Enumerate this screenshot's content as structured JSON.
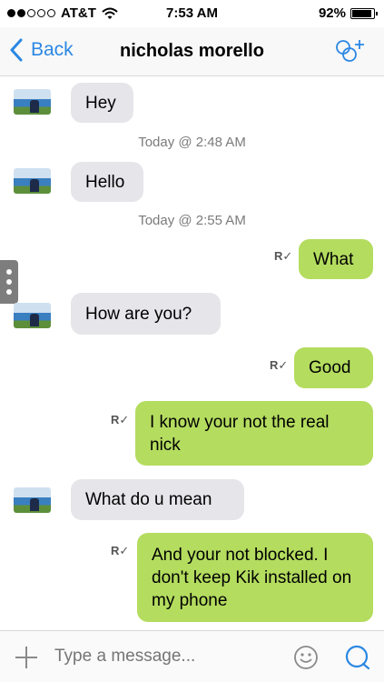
{
  "status_bar": {
    "carrier": "AT&T",
    "time": "7:53 AM",
    "battery": "92%",
    "battery_level": 0.92
  },
  "nav": {
    "back_label": "Back",
    "title": "nicholas morello"
  },
  "timestamps": [
    "Today @ 2:48 AM",
    "Today @ 2:55 AM"
  ],
  "messages": [
    {
      "from": "them",
      "text": "Hey"
    },
    {
      "from": "them",
      "text": "Hello"
    },
    {
      "from": "me",
      "text": "What",
      "receipt": "R"
    },
    {
      "from": "them",
      "text": "How are you?"
    },
    {
      "from": "me",
      "text": "Good",
      "receipt": "R"
    },
    {
      "from": "me",
      "text": "I know your not the real nick",
      "receipt": "R"
    },
    {
      "from": "them",
      "text": "What do u mean"
    },
    {
      "from": "me",
      "text": "And your not blocked. I don't keep Kik installed on my phone",
      "receipt": "R"
    }
  ],
  "composer": {
    "placeholder": "Type a message..."
  },
  "colors": {
    "accent": "#2b87e3",
    "outgoing_bubble": "#b4dc5f",
    "incoming_bubble": "#e5e5ea"
  }
}
